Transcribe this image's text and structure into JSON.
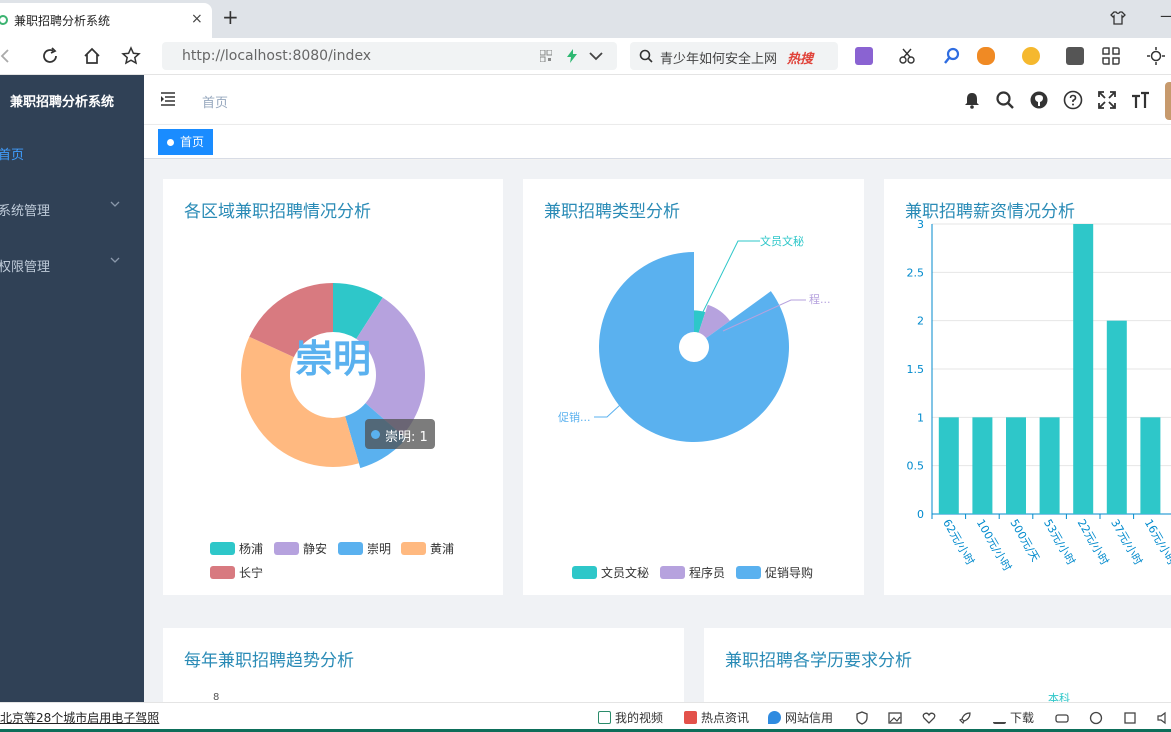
{
  "browser": {
    "tab_title": "兼职招聘分析系统",
    "tab_close": "×",
    "new_tab": "+",
    "url": "http://localhost:8080/index",
    "search_text": "青少年如何安全上网",
    "search_hot": "热搜",
    "win_min": "—"
  },
  "sidebar": {
    "title": "兼职招聘分析系统",
    "items": [
      {
        "label": "首页",
        "active": true
      },
      {
        "label": "系统管理",
        "active": false
      },
      {
        "label": "权限管理",
        "active": false
      }
    ]
  },
  "header": {
    "breadcrumb": "首页",
    "tag": "首页"
  },
  "colors": {
    "teal": "#2ec7c9",
    "purple": "#b6a2de",
    "blue": "#5ab1ef",
    "orange": "#ffb980",
    "red": "#d87a80",
    "title": "#2a8bb6",
    "sidebar": "#304156"
  },
  "cards": {
    "region": {
      "title": "各区域兼职招聘情况分析",
      "center_label": "崇明",
      "tooltip": "崇明: 1"
    },
    "type": {
      "title": "兼职招聘类型分析",
      "labels": [
        "文员文秘",
        "程...",
        "促销..."
      ]
    },
    "salary": {
      "title": "兼职招聘薪资情况分析"
    },
    "trend": {
      "title": "每年兼职招聘趋势分析",
      "partial_tick": "8"
    },
    "edu": {
      "title": "兼职招聘各学历要求分析",
      "partial_label": "本科"
    }
  },
  "chart_data": [
    {
      "type": "pie",
      "title": "各区域兼职招聘情况分析",
      "variant": "donut",
      "categories": [
        "杨浦",
        "静安",
        "崇明",
        "黄浦",
        "长宁"
      ],
      "values": [
        1,
        3,
        1,
        4,
        2
      ],
      "colors": [
        "#2ec7c9",
        "#b6a2de",
        "#5ab1ef",
        "#ffb980",
        "#d87a80"
      ],
      "legend": "bottom"
    },
    {
      "type": "pie",
      "title": "兼职招聘类型分析",
      "variant": "rose",
      "categories": [
        "文员文秘",
        "程序员",
        "促销导购"
      ],
      "values": [
        1,
        2,
        17
      ],
      "colors": [
        "#2ec7c9",
        "#b6a2de",
        "#5ab1ef"
      ],
      "legend": "bottom"
    },
    {
      "type": "bar",
      "title": "兼职招聘薪资情况分析",
      "categories": [
        "62元/小时",
        "100元/小时",
        "500元/天",
        "53元/小时",
        "22元/小时",
        "37元/小时",
        "16元/小时"
      ],
      "values": [
        1,
        1,
        1,
        1,
        3,
        2,
        1
      ],
      "ylim": [
        0,
        3
      ],
      "yticks": [
        0,
        0.5,
        1,
        1.5,
        2,
        2.5,
        3
      ],
      "color": "#2ec7c9",
      "grid": true
    }
  ],
  "statusbar": {
    "news": "北京等28个城市启用电子驾照",
    "items": [
      "我的视频",
      "热点资讯",
      "网站信用",
      "下载"
    ]
  }
}
